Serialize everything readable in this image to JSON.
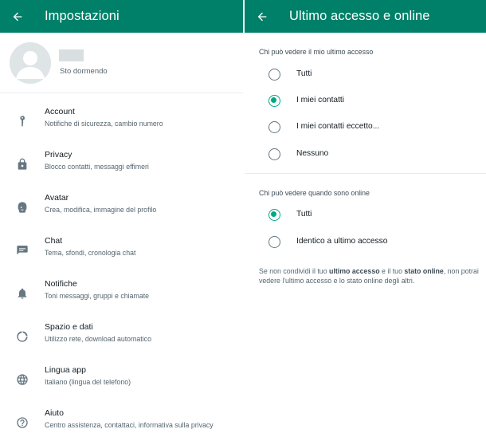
{
  "left": {
    "title": "Impostazioni",
    "profile": {
      "status": "Sto dormendo"
    },
    "items": [
      {
        "label": "Account",
        "sub": "Notifiche di sicurezza, cambio numero",
        "icon": "key-icon"
      },
      {
        "label": "Privacy",
        "sub": "Blocco contatti, messaggi effimeri",
        "icon": "lock-icon"
      },
      {
        "label": "Avatar",
        "sub": "Crea, modifica, immagine del profilo",
        "icon": "avatar-icon"
      },
      {
        "label": "Chat",
        "sub": "Tema, sfondi, cronologia chat",
        "icon": "chat-icon"
      },
      {
        "label": "Notifiche",
        "sub": "Toni messaggi, gruppi e chiamate",
        "icon": "bell-icon"
      },
      {
        "label": "Spazio e dati",
        "sub": "Utilizzo rete, download automatico",
        "icon": "storage-icon"
      },
      {
        "label": "Lingua app",
        "sub": "Italiano (lingua del telefono)",
        "icon": "globe-icon"
      },
      {
        "label": "Aiuto",
        "sub": "Centro assistenza, contattaci, informativa sulla privacy",
        "icon": "help-icon"
      }
    ]
  },
  "right": {
    "title": "Ultimo accesso e online",
    "last_seen": {
      "heading": "Chi può vedere il mio ultimo accesso",
      "options": [
        "Tutti",
        "I miei contatti",
        "I miei contatti eccetto...",
        "Nessuno"
      ],
      "selected": "I miei contatti"
    },
    "online": {
      "heading": "Chi può vedere quando sono online",
      "options": [
        "Tutti",
        "Identico a ultimo accesso"
      ],
      "selected": "Tutti"
    },
    "note": {
      "part1": "Se non condividi il tuo ",
      "bold1": "ultimo accesso",
      "part2": " e il tuo ",
      "bold2": "stato online",
      "part3": ", non potrai vedere l'ultimo accesso e lo stato online degli altri."
    }
  },
  "colors": {
    "appbar": "#008069",
    "accent": "#00a884",
    "icon_gray": "#667781"
  }
}
